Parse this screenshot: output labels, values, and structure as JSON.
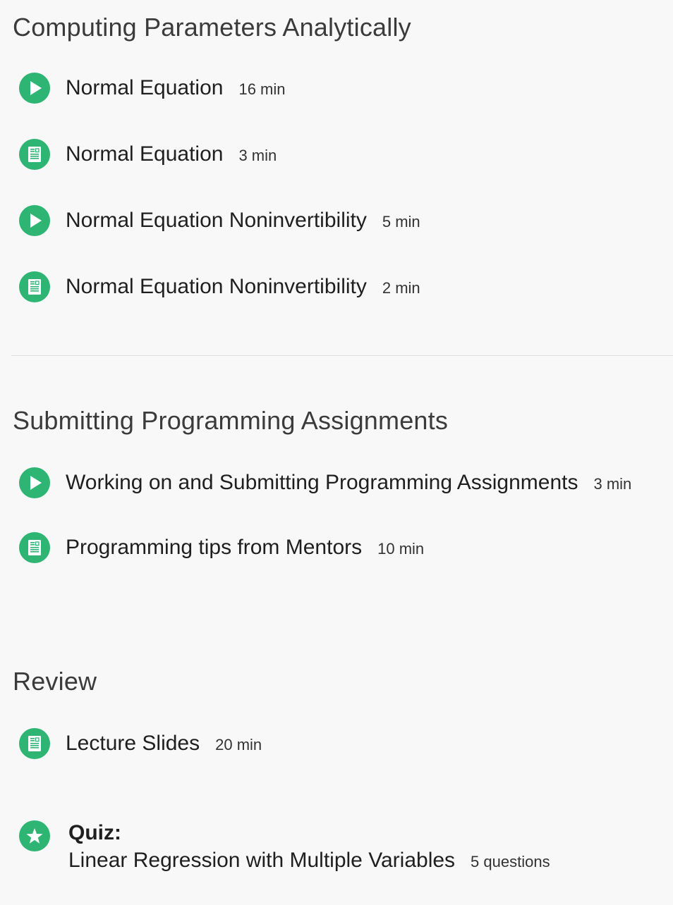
{
  "sections": [
    {
      "title": "Computing Parameters Analytically",
      "items": [
        {
          "type": "video",
          "icon": "play-icon",
          "title": "Normal Equation",
          "meta": "16 min"
        },
        {
          "type": "reading",
          "icon": "reading-icon",
          "title": "Normal Equation",
          "meta": "3 min"
        },
        {
          "type": "video",
          "icon": "play-icon",
          "title": "Normal Equation Noninvertibility",
          "meta": "5 min"
        },
        {
          "type": "reading",
          "icon": "reading-icon",
          "title": "Normal Equation Noninvertibility",
          "meta": "2 min"
        }
      ]
    },
    {
      "title": "Submitting Programming Assignments",
      "items": [
        {
          "type": "video",
          "icon": "play-icon",
          "title": "Working on and Submitting Programming Assignments",
          "meta": "3 min"
        },
        {
          "type": "reading",
          "icon": "reading-icon",
          "title": "Programming tips from Mentors",
          "meta": "10 min"
        }
      ]
    },
    {
      "title": "Review",
      "items": [
        {
          "type": "reading",
          "icon": "reading-icon",
          "title": "Lecture Slides",
          "meta": "20 min"
        }
      ],
      "quiz": {
        "icon": "star-icon",
        "label": "Quiz:",
        "title": "Linear Regression with Multiple Variables",
        "meta": "5 questions"
      }
    }
  ],
  "colors": {
    "accent": "#2fb573",
    "background": "#f8f8f8",
    "divider": "#dedede"
  }
}
